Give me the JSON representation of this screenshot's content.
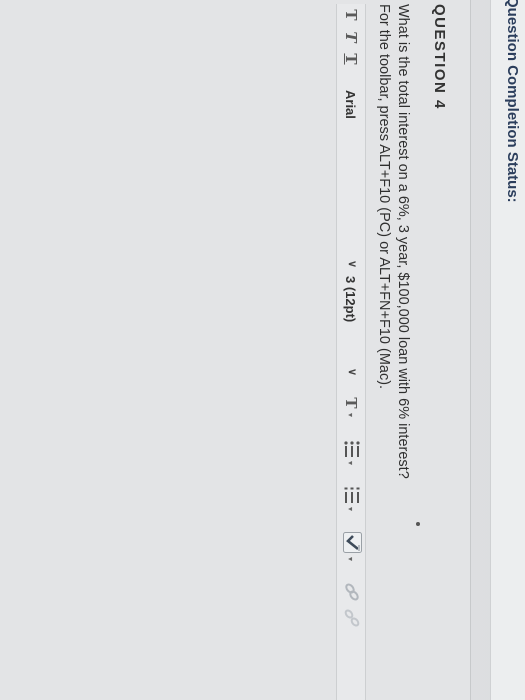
{
  "header": {
    "status_label": "Question Completion Status:"
  },
  "question": {
    "title": "QUESTION 4",
    "text": "What is the total interest on a 6%, 3 year, $100,000 loan with 6% interest?",
    "toolbar_hint": "For the toolbar, press ALT+F10 (PC) or ALT+FN+F10 (Mac)."
  },
  "toolbar": {
    "bold_glyph": "T",
    "italic_glyph": "T",
    "underline_glyph": "T",
    "font_family": "Arial",
    "font_size": "3 (12pt)",
    "text_color_glyph": "T",
    "chevron": "∨",
    "caret": "▾"
  }
}
